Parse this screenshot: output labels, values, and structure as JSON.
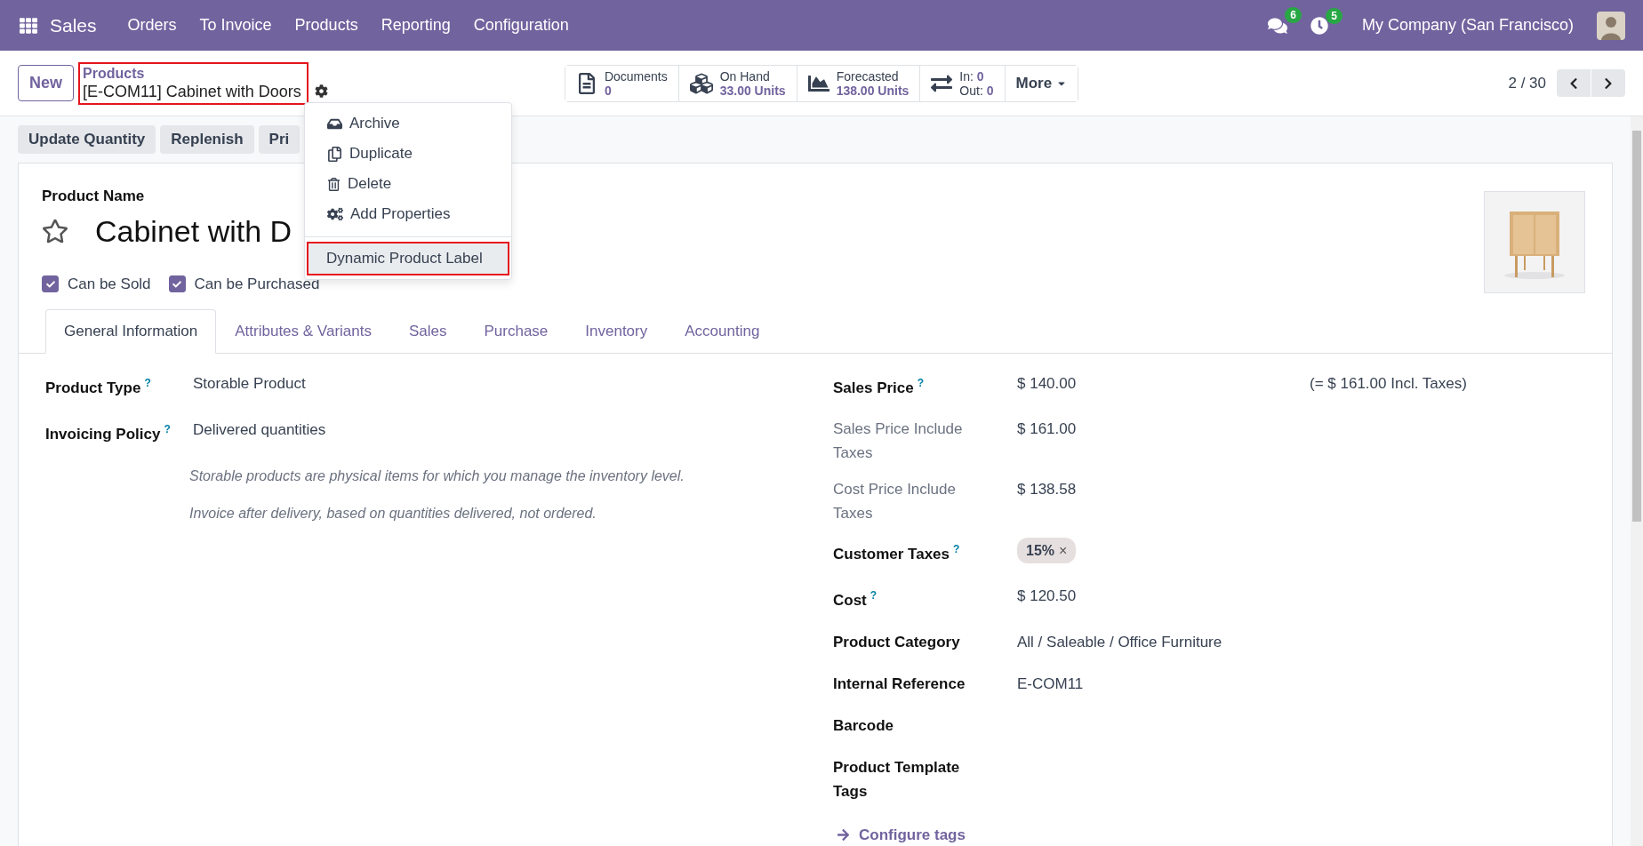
{
  "navbar": {
    "app": "Sales",
    "menu": [
      "Orders",
      "To Invoice",
      "Products",
      "Reporting",
      "Configuration"
    ],
    "messages_badge": "6",
    "activities_badge": "5",
    "company": "My Company (San Francisco)"
  },
  "control_panel": {
    "new_button": "New",
    "breadcrumb": {
      "parent": "Products",
      "current": "[E-COM11] Cabinet with Doors",
      "highlighted": true
    },
    "stat_buttons": [
      {
        "kind": "documents",
        "label": "Documents",
        "value": "0"
      },
      {
        "kind": "on_hand",
        "label": "On Hand",
        "value": "33.00 Units"
      },
      {
        "kind": "forecasted",
        "label": "Forecasted",
        "value": "138.00 Units"
      },
      {
        "kind": "in_out",
        "in_label": "In:",
        "in_value": "0",
        "out_label": "Out:",
        "out_value": "0"
      }
    ],
    "more_button": "More",
    "pager": "2 / 30"
  },
  "action_menu": {
    "items": [
      {
        "kind": "archive",
        "label": "Archive",
        "highlighted": false
      },
      {
        "kind": "duplicate",
        "label": "Duplicate",
        "highlighted": false
      },
      {
        "kind": "delete",
        "label": "Delete",
        "highlighted": false
      },
      {
        "kind": "properties",
        "label": "Add Properties",
        "highlighted": false
      }
    ],
    "reports": [
      {
        "label": "Dynamic Product Label",
        "highlighted": true
      }
    ]
  },
  "action_buttons": [
    "Update Quantity",
    "Replenish",
    "Pri"
  ],
  "form": {
    "name_label": "Product Name",
    "name": "Cabinet with D",
    "favorite": false,
    "checkboxes": [
      {
        "label": "Can be Sold",
        "checked": true
      },
      {
        "label": "Can be Purchased",
        "checked": true
      }
    ],
    "image": {
      "kind": "picture"
    },
    "tabs": [
      {
        "label": "General Information",
        "selected": true
      },
      {
        "label": "Attributes & Variants",
        "selected": false
      },
      {
        "label": "Sales",
        "selected": false
      },
      {
        "label": "Purchase",
        "selected": false
      },
      {
        "label": "Inventory",
        "selected": false
      },
      {
        "label": "Accounting",
        "selected": false
      }
    ],
    "left_fields": [
      {
        "label": "Product Type",
        "help": "?",
        "value": "Storable Product"
      },
      {
        "label": "Invoicing Policy",
        "help": "?",
        "value": "Delivered quantities"
      }
    ],
    "notes": [
      "Storable products are physical items for which you manage the inventory level.",
      "Invoice after delivery, based on quantities delivered, not ordered."
    ],
    "right_fields": [
      {
        "label": "Sales Price",
        "help": "?",
        "muted": false,
        "value": "$ 140.00",
        "extra": "(= $ 161.00 Incl. Taxes)"
      },
      {
        "label": "Sales Price Include Taxes",
        "muted": true,
        "value": "$ 161.00"
      },
      {
        "label": "Cost Price Include Taxes",
        "muted": true,
        "value": "$ 138.58"
      },
      {
        "label": "Customer Taxes",
        "help": "?",
        "muted": false,
        "tags": [
          {
            "label": "15%",
            "remove": "×"
          }
        ]
      },
      {
        "label": "Cost",
        "help": "?",
        "muted": false,
        "value": "$ 120.50"
      },
      {
        "label": "Product Category",
        "muted": false,
        "value": "All / Saleable / Office Furniture"
      },
      {
        "label": "Internal Reference",
        "muted": false,
        "value": "E-COM11"
      },
      {
        "label": "Barcode",
        "muted": false
      },
      {
        "label": "Product Template Tags",
        "muted": false
      }
    ],
    "configure_link": "Configure tags"
  }
}
